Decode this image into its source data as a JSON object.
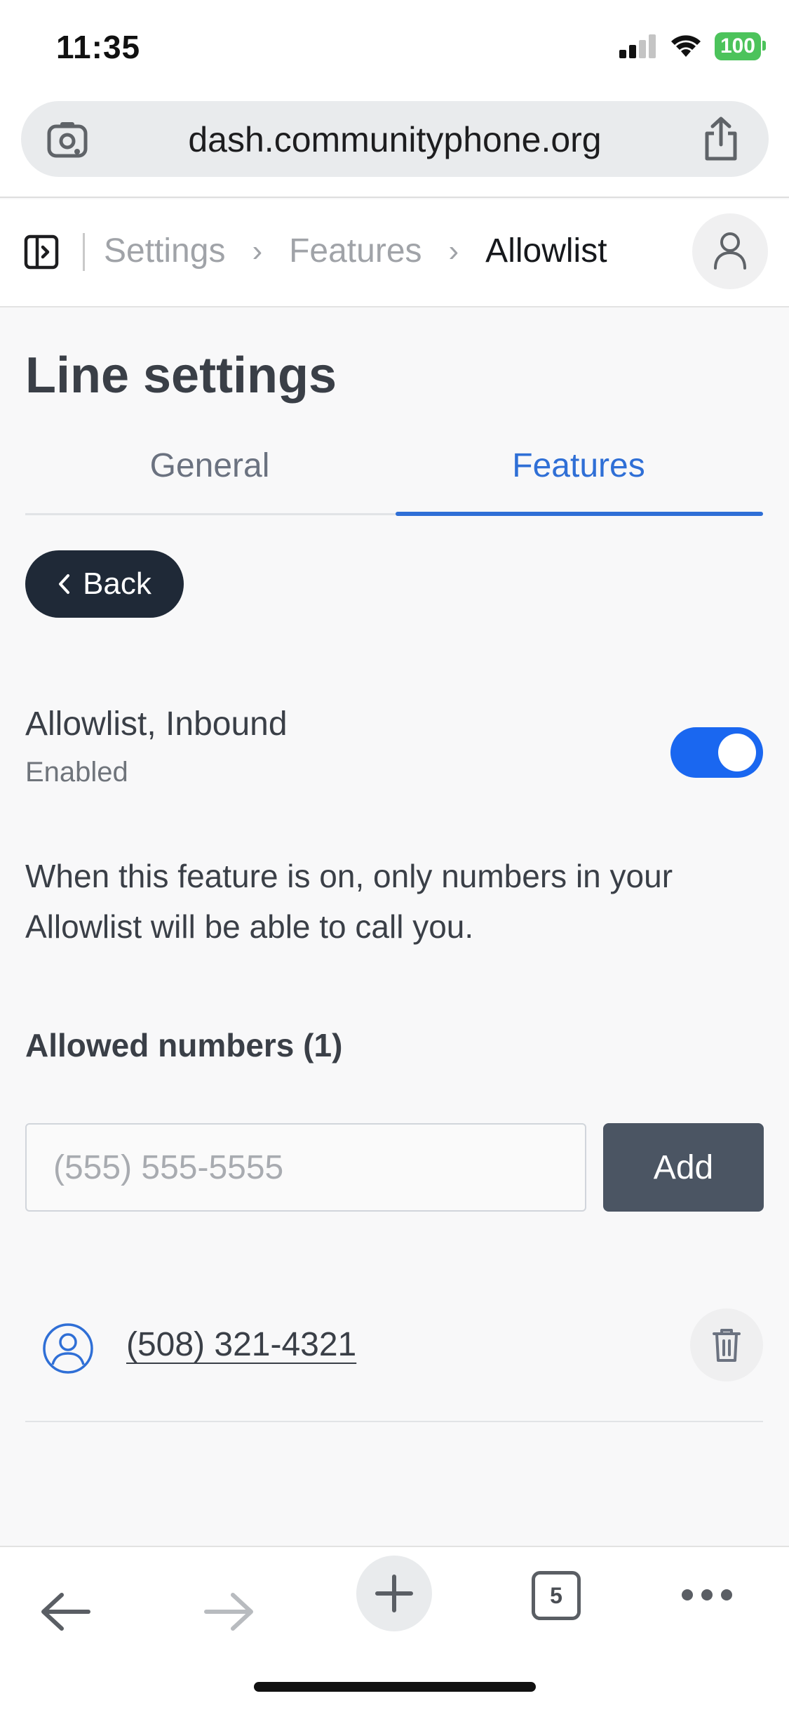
{
  "status_bar": {
    "time": "11:35",
    "battery": "100",
    "icons": [
      "signal-icon",
      "wifi-icon",
      "battery-icon"
    ]
  },
  "browser": {
    "url": "dash.communityphone.org",
    "tab_count": "5"
  },
  "breadcrumb": {
    "items": [
      "Settings",
      "Features",
      "Allowlist"
    ]
  },
  "page": {
    "title": "Line settings",
    "tabs": [
      {
        "label": "General",
        "active": false
      },
      {
        "label": "Features",
        "active": true
      }
    ],
    "back_label": "Back"
  },
  "feature": {
    "title": "Allowlist, Inbound",
    "status": "Enabled",
    "enabled": true,
    "description": "When this feature is on, only numbers in your Allowlist will be able to call you."
  },
  "allowed": {
    "heading": "Allowed numbers (1)",
    "input_placeholder": "(555) 555-5555",
    "add_label": "Add",
    "numbers": [
      "(508) 321-4321"
    ]
  },
  "colors": {
    "accent": "#2f6fd6",
    "toggle": "#1a67f0",
    "dark_button": "#1f2937",
    "add_button": "#4b5563",
    "battery": "#4cc35b"
  }
}
